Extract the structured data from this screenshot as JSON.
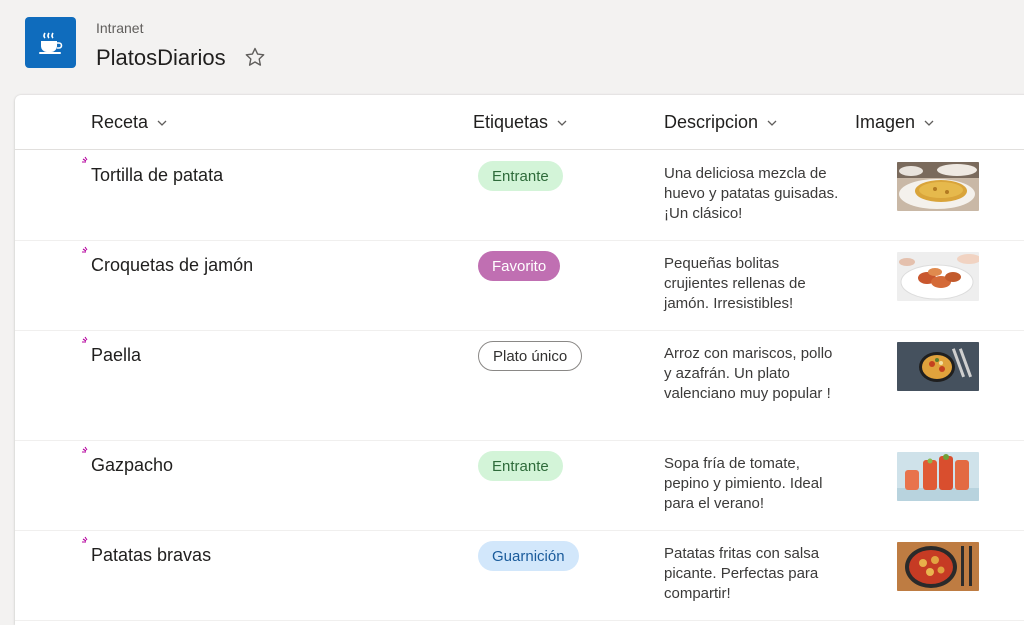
{
  "site": {
    "parent": "Intranet",
    "title": "PlatosDiarios",
    "logo_icon": "coffee-cup-icon",
    "logo_color": "#0f6cbd"
  },
  "columns": {
    "receta": "Receta",
    "etiquetas": "Etiquetas",
    "descripcion": "Descripcion",
    "imagen": "Imagen"
  },
  "rows": [
    {
      "receta": "Tortilla de patata",
      "etiqueta": "Entrante",
      "descripcion": "Una deliciosa mezcla de huevo y patatas guisadas. ¡Un clásico!"
    },
    {
      "receta": "Croquetas de jamón",
      "etiqueta": "Favorito",
      "descripcion": "Pequeñas bolitas crujientes rellenas de jamón. Irresistibles!"
    },
    {
      "receta": "Paella",
      "etiqueta": "Plato único",
      "descripcion": "Arroz con mariscos, pollo y azafrán. Un plato valenciano muy popular !"
    },
    {
      "receta": "Gazpacho",
      "etiqueta": "Entrante",
      "descripcion": "Sopa fría de tomate, pepino y pimiento. Ideal para el verano!"
    },
    {
      "receta": "Patatas bravas",
      "etiqueta": "Guarnición",
      "descripcion": "Patatas fritas con salsa picante. Perfectas para compartir!"
    }
  ],
  "tag_colors": {
    "Entrante": "#d3f4d8",
    "Favorito": "#c06fb2",
    "Plato único": "#ffffff",
    "Guarnición": "#d2e7fb"
  }
}
